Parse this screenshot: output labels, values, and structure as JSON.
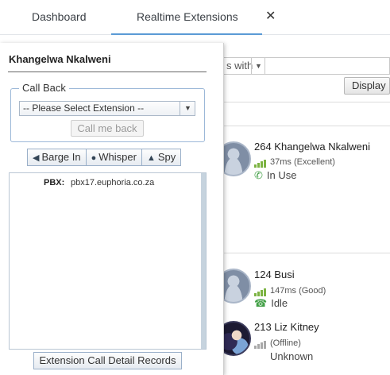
{
  "tabs": [
    {
      "label": "Dashboard"
    },
    {
      "label": "Realtime Extensions"
    }
  ],
  "tab_close_glyph": "✕",
  "background": {
    "filter_select_value": "s with",
    "display_button": "Display",
    "extensions": [
      {
        "name": "264 Khangelwa Nkalweni",
        "signal": "37ms (Excellent)",
        "status": "In Use",
        "status_icon": "phone-icon",
        "bars": 4
      },
      {
        "name": "124 Busi",
        "signal": "147ms (Good)",
        "status": "Idle",
        "status_icon": "phone-hangup-icon",
        "bars": 4
      },
      {
        "name": "213 Liz Kitney",
        "signal": "(Offline)",
        "status": "Unknown",
        "status_icon": "",
        "bars": 4
      }
    ]
  },
  "panel": {
    "title": "Khangelwa Nkalweni",
    "call_back": {
      "legend": "Call Back",
      "select_value": "-- Please Select Extension --",
      "call_button": "Call me back"
    },
    "actions": [
      {
        "label": "Barge In",
        "icon": "megaphone-icon"
      },
      {
        "label": "Whisper",
        "icon": "microphone-icon"
      },
      {
        "label": "Spy",
        "icon": "spy-icon"
      }
    ],
    "pbx_label": "PBX:",
    "pbx_value": "pbx17.euphoria.co.za",
    "cdr_button": "Extension Call Detail Records"
  },
  "colors": {
    "accent": "#5b9bd5",
    "signal_good": "#7cb342",
    "in_use": "#43a047"
  }
}
